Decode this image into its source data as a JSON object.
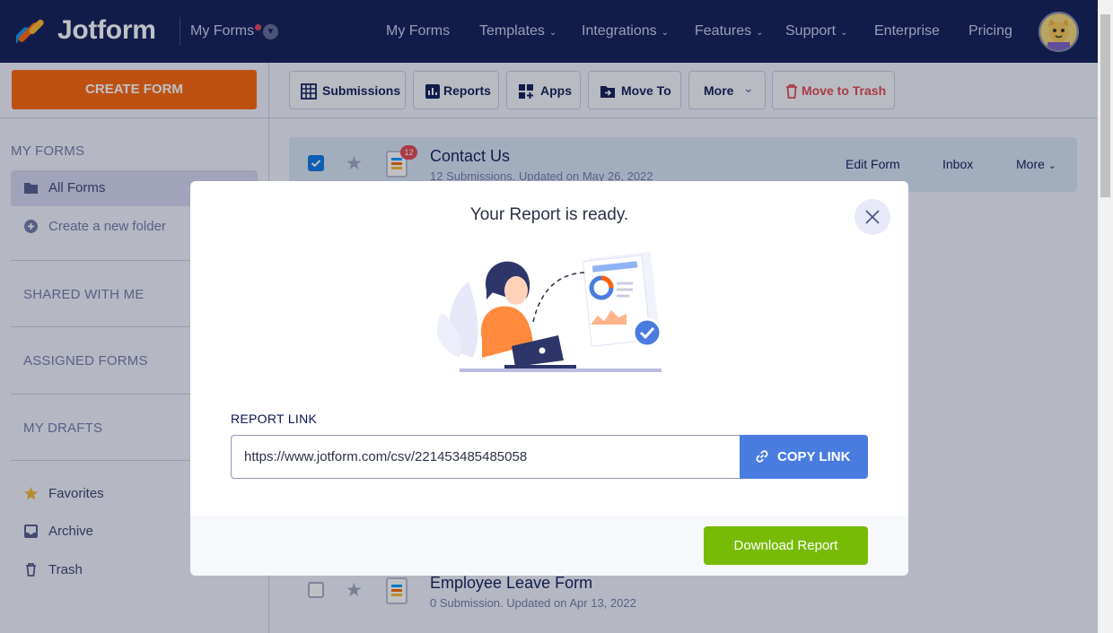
{
  "topnav": {
    "brand": "Jotform",
    "myforms_dropdown": "My Forms",
    "links": [
      {
        "label": "My Forms",
        "caret": false
      },
      {
        "label": "Templates",
        "caret": true
      },
      {
        "label": "Integrations",
        "caret": true
      },
      {
        "label": "Features",
        "caret": true
      },
      {
        "label": "Support",
        "caret": true
      },
      {
        "label": "Enterprise",
        "caret": false
      },
      {
        "label": "Pricing",
        "caret": false
      }
    ]
  },
  "sidebar": {
    "create_label": "CREATE FORM",
    "my_forms_heading": "MY FORMS",
    "all_forms": "All Forms",
    "create_folder": "Create a new folder",
    "shared_heading": "SHARED WITH ME",
    "assigned_heading": "ASSIGNED FORMS",
    "drafts_heading": "MY DRAFTS",
    "favorites": "Favorites",
    "archive": "Archive",
    "trash": "Trash"
  },
  "toolbar": {
    "submissions": "Submissions",
    "reports": "Reports",
    "apps": "Apps",
    "move_to": "Move To",
    "more": "More",
    "move_to_trash": "Move to Trash"
  },
  "forms": [
    {
      "title": "Contact Us",
      "subtitle": "12 Submissions. Updated on May 26, 2022",
      "badge": "12",
      "edit": "Edit Form",
      "inbox": "Inbox",
      "more": "More"
    },
    {
      "title": "Employee Leave Form",
      "subtitle": "0 Submission. Updated on Apr 13, 2022"
    }
  ],
  "modal": {
    "title": "Your Report is ready.",
    "link_label": "REPORT LINK",
    "link_value": "https://www.jotform.com/csv/221453485485058",
    "copy_label": "COPY LINK",
    "download_label": "Download Report"
  },
  "colors": {
    "nav_bg": "#0a1551",
    "create_orange": "#ff6100",
    "copy_blue": "#4a7ce0",
    "download_green": "#78bb07",
    "trash_red": "#e23f4d"
  }
}
